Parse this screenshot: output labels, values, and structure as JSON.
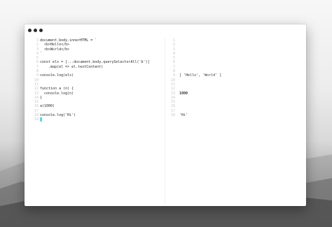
{
  "window": {
    "controls": [
      "close",
      "minimize",
      "zoom"
    ]
  },
  "editor": {
    "lines": [
      {
        "n": "1",
        "text": "document.body.innerHTML = `"
      },
      {
        "n": "2",
        "text": "  <b>Hello</b>"
      },
      {
        "n": "3",
        "text": "  <b>World</b>"
      },
      {
        "n": "4",
        "text": "`"
      },
      {
        "n": "5",
        "text": ""
      },
      {
        "n": "6",
        "text": "const els = [...document.body.querySelectorAll('b')]"
      },
      {
        "n": "7",
        "text": "    .map(el => el.textContent)"
      },
      {
        "n": "8",
        "text": ""
      },
      {
        "n": "9",
        "text": "console.log(els)"
      },
      {
        "n": "10",
        "text": ""
      },
      {
        "n": "11",
        "text": ""
      },
      {
        "n": "12",
        "text": "function a (n) {"
      },
      {
        "n": "13",
        "text": "  console.log(n)"
      },
      {
        "n": "14",
        "text": "}"
      },
      {
        "n": "15",
        "text": ""
      },
      {
        "n": "16",
        "text": "a(1000)"
      },
      {
        "n": "17",
        "text": ""
      },
      {
        "n": "18",
        "text": "console.log('Hi')"
      },
      {
        "n": "19",
        "text": ""
      }
    ]
  },
  "output": {
    "lines": [
      {
        "n": "1",
        "text": ""
      },
      {
        "n": "2",
        "text": ""
      },
      {
        "n": "3",
        "text": ""
      },
      {
        "n": "4",
        "text": ""
      },
      {
        "n": "5",
        "text": ""
      },
      {
        "n": "6",
        "text": ""
      },
      {
        "n": "7",
        "text": ""
      },
      {
        "n": "8",
        "text": ""
      },
      {
        "n": "9",
        "text": "[ 'Hello', 'World' ]"
      },
      {
        "n": "10",
        "text": ""
      },
      {
        "n": "11",
        "text": ""
      },
      {
        "n": "12",
        "text": ""
      },
      {
        "n": "13",
        "text": "1000"
      },
      {
        "n": "14",
        "text": ""
      },
      {
        "n": "15",
        "text": ""
      },
      {
        "n": "16",
        "text": ""
      },
      {
        "n": "17",
        "text": ""
      },
      {
        "n": "18",
        "text": "'Hi'"
      }
    ]
  },
  "colors": {
    "cursor": "#5ad6ee",
    "line_numbers": "#c6c6c6"
  }
}
